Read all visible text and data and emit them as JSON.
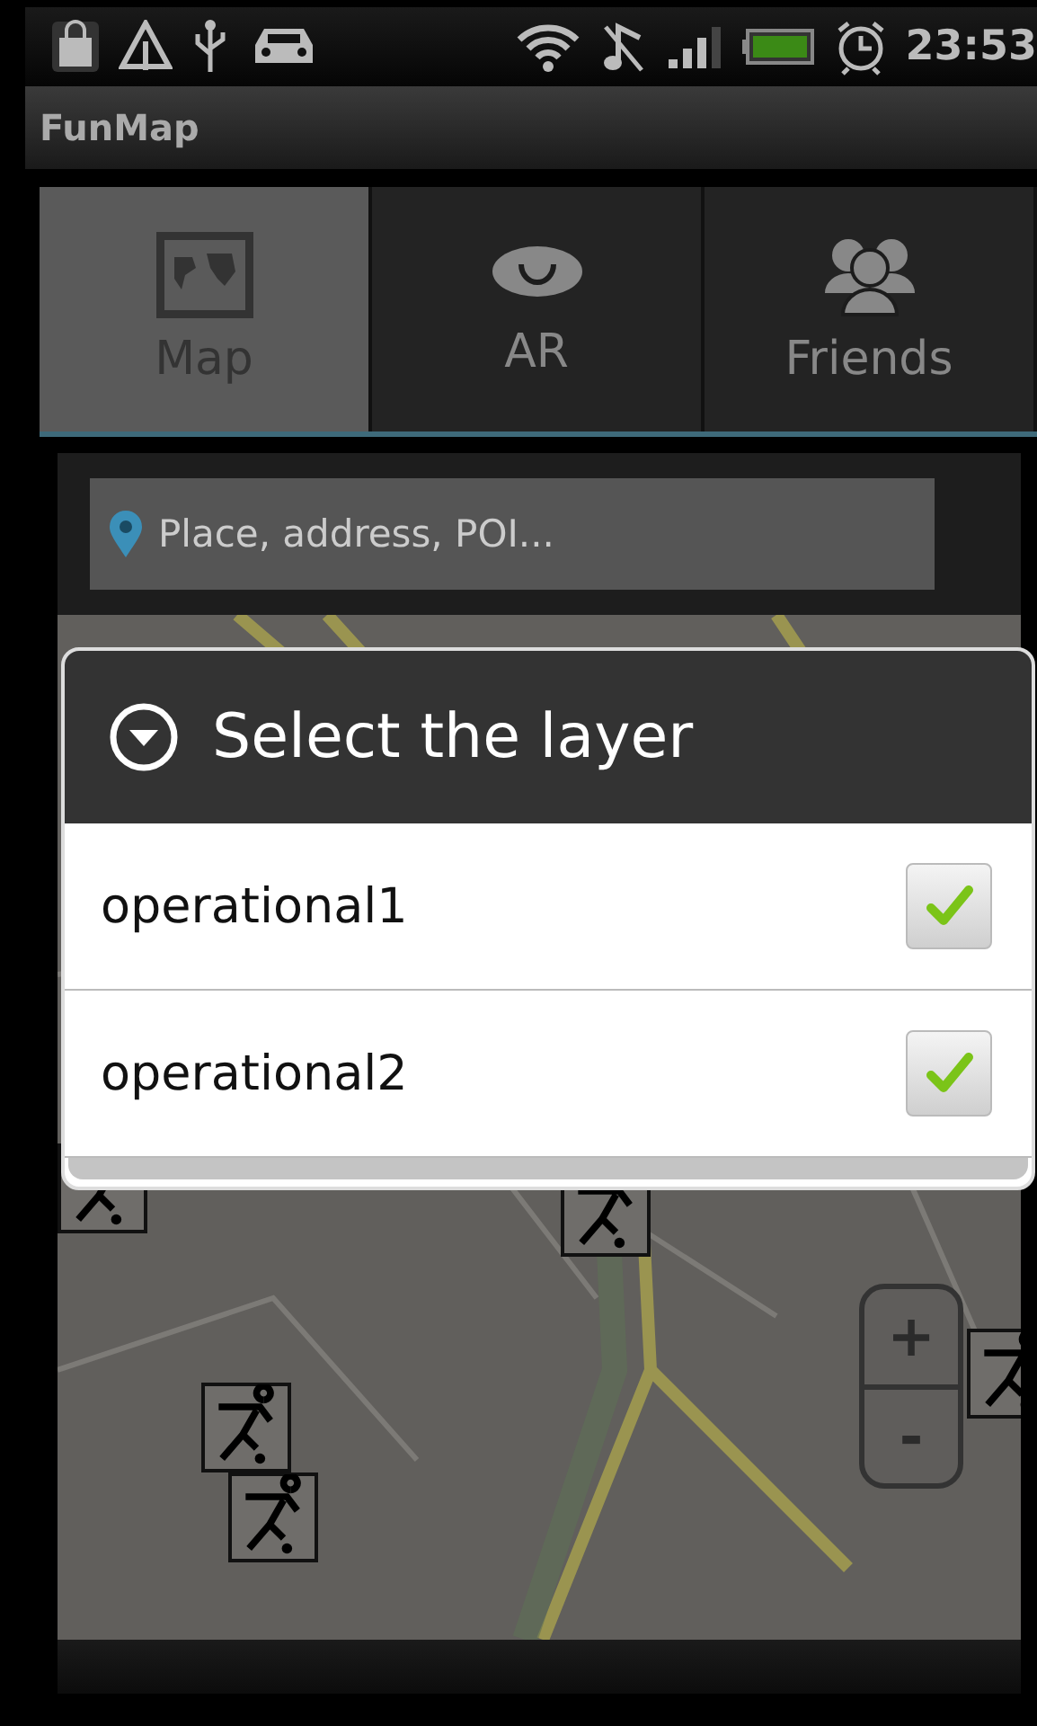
{
  "status_bar": {
    "time": "23:53"
  },
  "app_bar": {
    "title": "FunMap"
  },
  "tabs": [
    {
      "label": "Map",
      "kind": "map",
      "selected": true
    },
    {
      "label": "AR",
      "kind": "eye",
      "selected": false
    },
    {
      "label": "Friends",
      "kind": "people",
      "selected": false
    }
  ],
  "search": {
    "placeholder": "Place, address, POI..."
  },
  "map": {
    "zoom_in": "+",
    "zoom_out": "-"
  },
  "dialog": {
    "title": "Select the layer",
    "layers": [
      {
        "name": "operational1",
        "checked": true
      },
      {
        "name": "operational2",
        "checked": true
      }
    ]
  }
}
